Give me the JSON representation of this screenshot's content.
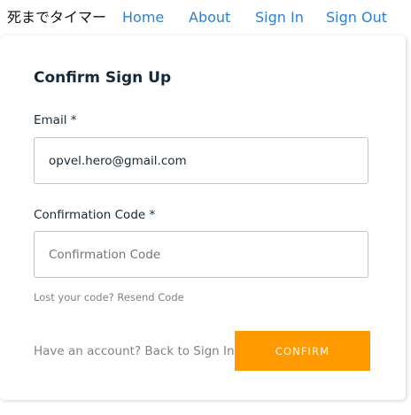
{
  "nav": {
    "brand": "死までタイマー",
    "links": {
      "home": "Home",
      "about": "About",
      "sign_in": "Sign In",
      "sign_out": "Sign Out"
    },
    "link_color": "#2d7fd1"
  },
  "form": {
    "title": "Confirm Sign Up",
    "email": {
      "label": "Email *",
      "value": "opvel.hero@gmail.com"
    },
    "code": {
      "label": "Confirmation Code *",
      "placeholder": "Confirmation Code",
      "value": ""
    },
    "hint": {
      "prefix": "Lost your code? ",
      "resend_label": "Resend Code"
    },
    "footer": {
      "prefix": "Have an account? ",
      "back_label": "Back to Sign In"
    },
    "confirm_label": "CONFIRM",
    "accent_color": "#ff9900"
  }
}
